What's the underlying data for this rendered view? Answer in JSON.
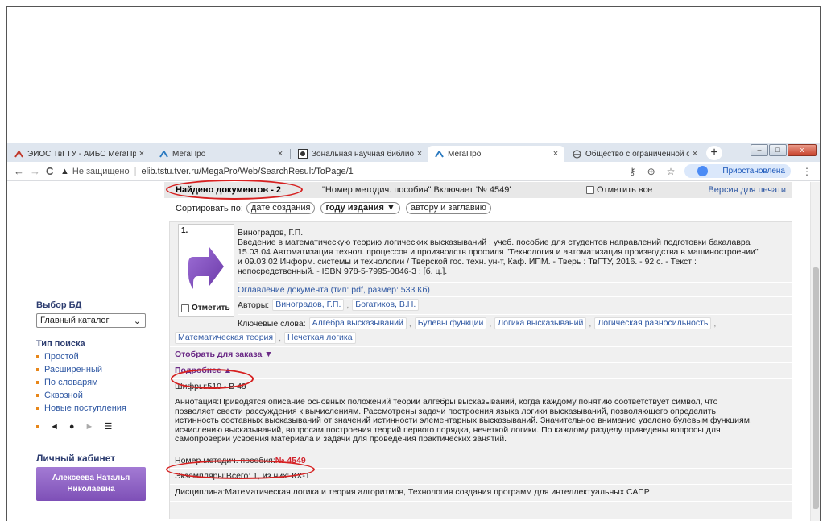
{
  "browser": {
    "tabs": [
      {
        "label": "ЭИОС ТвГТУ - АИБС МегаПро",
        "icon": "megapro-logo-icon",
        "active": false
      },
      {
        "label": "МегаПро",
        "icon": "megapro-logo-icon",
        "active": false
      },
      {
        "label": "Зональная научная библиотека",
        "icon": "library-icon",
        "active": false
      },
      {
        "label": "МегаПро",
        "icon": "megapro-logo-icon",
        "active": true
      },
      {
        "label": "Общество с ограниченной отв",
        "icon": "globe-icon",
        "active": false
      }
    ],
    "close_glyph": "×",
    "new_tab": "+",
    "nav": {
      "back": "←",
      "forward": "→",
      "reload": "C"
    },
    "security_label": "Не защищено",
    "url": "elib.tstu.tver.ru/MegaPro/Web/SearchResult/ToPage/1",
    "profile_label": "Приостановлена"
  },
  "sidebar": {
    "db_heading": "Выбор БД",
    "db_selected": "Главный каталог",
    "search_heading": "Тип поиска",
    "search_types": [
      "Простой",
      "Расширенный",
      "По словарям",
      "Сквозной",
      "Новые поступления"
    ],
    "pager": {
      "prev": "◄",
      "current": "●",
      "next": "►",
      "menu": "☰"
    },
    "cabinet_heading": "Личный кабинет",
    "user_name": "Алексеева Наталья Николаевна"
  },
  "results": {
    "found": "Найдено документов - 2",
    "query": "\"Номер методич. пособия\" Включает '№ 4549'",
    "mark_all": "Отметить все",
    "print_version": "Версия для печати",
    "sort_label": "Сортировать по:",
    "sort_options": [
      {
        "label": "дате создания",
        "active": false
      },
      {
        "label": "году издания ▼",
        "active": true
      },
      {
        "label": "автору и заглавию",
        "active": false
      }
    ]
  },
  "record": {
    "number": "1.",
    "mark_label": "Отметить",
    "bibl_lines": [
      "Виноградов, Г.П.",
      "Введение в математическую теорию логических высказываний : учеб. пособие для студентов направлений подготовки бакалавра",
      "15.03.04 Автоматизация технол. процессов и производств профиля \"Технология и автоматизация производства в машиностроении\"",
      "и 09.03.02 Информ. системы и технологии / Тверской гос. техн. ун-т, Каф. ИПМ. - Тверь : ТвГТУ, 2016. - 92 с. - Текст :",
      "непосредственный. - ISBN 978-5-7995-0846-3 : [б. ц.]."
    ],
    "contents_link": "Оглавление документа (тип: pdf, размер: 533 Кб)",
    "authors_label": "Авторы:",
    "authors": [
      "Виноградов, Г.П.",
      "Богатиков, В.Н."
    ],
    "keywords_label": "Ключевые слова:",
    "keywords_line1": [
      "Алгебра высказываний",
      "Булевы функции",
      "Логика высказываний",
      "Логическая равносильность"
    ],
    "keywords_line2": [
      "Математическая теория",
      "Нечеткая логика"
    ],
    "select_for_order": "Отобрать для заказа ▼",
    "more": "Подробнее ▲",
    "shifr": "Шифры:510 - В 49",
    "annotation_lines": [
      "Аннотация:Приводятся описание основных положений теории алгебры высказываний, когда каждому понятию соответствует символ, что",
      "позволяет свести рассуждения к вычислениям. Рассмотрены задачи построения языка логики высказываний, позволяющего определить",
      "истинность составных высказываний от значений истинности элементарных высказываний. Значительное внимание уделено булевым функциям,",
      "исчислению высказываний, вопросам построения теорий первого порядка, нечеткой логики. По каждому разделу приведены вопросы для",
      "самопроверки усвоения материала и задачи для проведения практических занятий."
    ],
    "method_label": "Номер методич. пособия:",
    "method_value": "№ 4549",
    "copies": "Экземпляры:Всего: 1, из них: КХ-1",
    "discipline": "Дисциплина:Математическая логика и теория алгоритмов, Технология создания программ для интеллектуальных САПР"
  },
  "colors": {
    "link": "#2f58a3",
    "accent_orange": "#e7861a",
    "highlight_red": "#d62020",
    "user_button": "#8a5ec2"
  }
}
